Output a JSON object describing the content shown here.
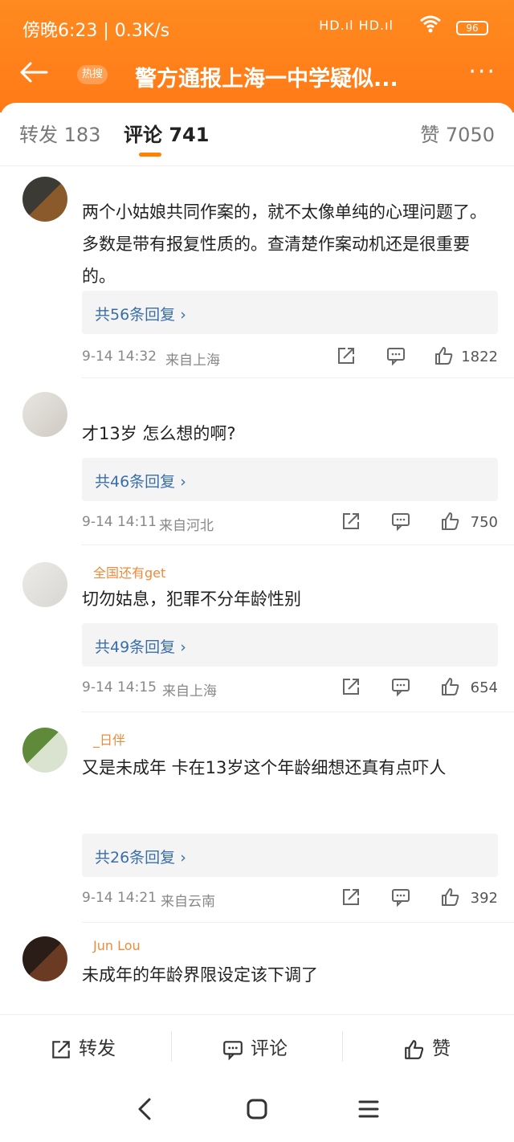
{
  "status": {
    "time": "傍晚6:23 | 0.3K/s",
    "signal": "HD.ıl HD.ıl",
    "battery": "96"
  },
  "nav": {
    "hot_badge": "热搜",
    "title": "警方通报上海一中学疑似..."
  },
  "tabs": {
    "repost": "转发 183",
    "comment": "评论 741",
    "like": "赞 7050"
  },
  "comments": [
    {
      "user": "",
      "text": "两个小姑娘共同作案的，就不太像单纯的心理问题了。多数是带有报复性质的。查清楚作案动机还是很重要的。",
      "replies": "共56条回复 ›",
      "date": "9-14 14:32",
      "location": "来自上海",
      "likes": "1822"
    },
    {
      "user": "",
      "text": "才13岁 怎么想的啊?",
      "replies": "共46条回复 ›",
      "date": "9-14 14:11",
      "location": "来自河北",
      "likes": "750"
    },
    {
      "user": "全国还有get",
      "text": "切勿姑息，犯罪不分年龄性别",
      "replies": "共49条回复 ›",
      "date": "9-14 14:15",
      "location": "来自上海",
      "likes": "654"
    },
    {
      "user": "_日伴",
      "text": "又是未成年  卡在13岁这个年龄细想还真有点吓人",
      "replies": "共26条回复 ›",
      "date": "9-14 14:21",
      "location": "来自云南",
      "likes": "392"
    },
    {
      "user": "Jun Lou",
      "text": "未成年的年龄界限设定该下调了",
      "replies": "",
      "date": "",
      "location": "",
      "likes": ""
    }
  ],
  "actions": {
    "repost": "转发",
    "comment": "评论",
    "like": "赞"
  },
  "colors": {
    "header": "#ff7a18",
    "accent": "#ff8200",
    "link": "#3a6ea8"
  }
}
